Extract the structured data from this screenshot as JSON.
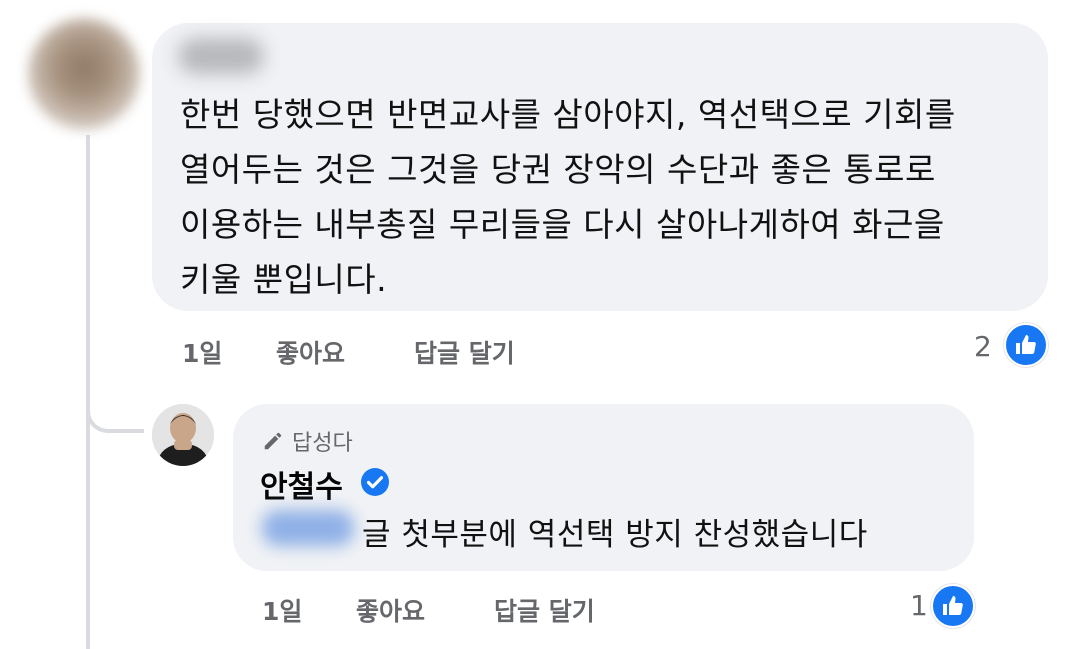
{
  "colors": {
    "bubble_bg": "#f0f2f5",
    "action_text": "#65676b",
    "like_blue": "#1877f2",
    "thread_line": "#d9dbe0"
  },
  "comment": {
    "text": "한번 당했으면 반면교사를 삼아야지, 역선택으로 기회를\n열어두는 것은 그것을 당권 장악의 수단과 좋은 통로로\n이용하는 내부총질 무리들을 다시 살아나게하여 화근을\n키울 뿐입니다.",
    "time": "1일",
    "like_label": "좋아요",
    "reply_label": "답글 달기",
    "like_count": "2",
    "like_icon": "thumbs-up-icon"
  },
  "reply": {
    "badge_icon": "pencil-icon",
    "badge_label": "답성다",
    "author": "안철수",
    "verified_icon": "verified-check-icon",
    "text": "글 첫부분에 역선택 방지 찬성했습니다",
    "time": "1일",
    "like_label": "좋아요",
    "reply_label": "답글 달기",
    "like_count": "1",
    "like_icon": "thumbs-up-icon"
  }
}
